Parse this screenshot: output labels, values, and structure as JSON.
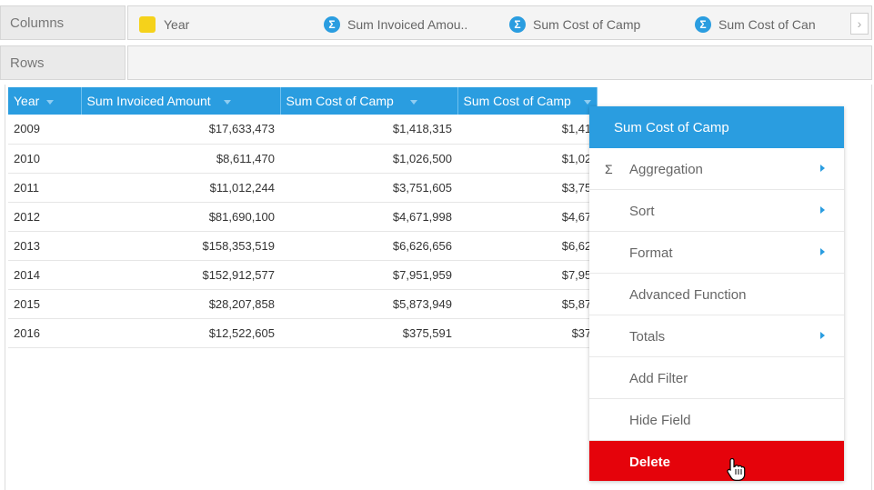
{
  "shelves": {
    "columns_label": "Columns",
    "rows_label": "Rows",
    "column_pills": [
      {
        "label": "Year",
        "kind": "dimension"
      },
      {
        "label": "Sum Invoiced Amou..",
        "kind": "measure"
      },
      {
        "label": "Sum Cost of Camp",
        "kind": "measure"
      },
      {
        "label": "Sum Cost of Can",
        "kind": "measure"
      }
    ],
    "scroll_right": "›"
  },
  "table": {
    "headers": [
      "Year",
      "Sum Invoiced Amount",
      "Sum Cost of Camp",
      "Sum Cost of Camp"
    ],
    "rows": [
      [
        "2009",
        "$17,633,473",
        "$1,418,315",
        "$1,41"
      ],
      [
        "2010",
        "$8,611,470",
        "$1,026,500",
        "$1,02"
      ],
      [
        "2011",
        "$11,012,244",
        "$3,751,605",
        "$3,75"
      ],
      [
        "2012",
        "$81,690,100",
        "$4,671,998",
        "$4,67"
      ],
      [
        "2013",
        "$158,353,519",
        "$6,626,656",
        "$6,62"
      ],
      [
        "2014",
        "$152,912,577",
        "$7,951,959",
        "$7,95"
      ],
      [
        "2015",
        "$28,207,858",
        "$5,873,949",
        "$5,87"
      ],
      [
        "2016",
        "$12,522,605",
        "$375,591",
        "$37"
      ]
    ]
  },
  "context_menu": {
    "title": "Sum Cost of Camp",
    "items": [
      {
        "label": "Aggregation",
        "icon": "sigma-icon",
        "submenu": true
      },
      {
        "label": "Sort",
        "submenu": true
      },
      {
        "label": "Format",
        "submenu": true
      },
      {
        "label": "Advanced Function",
        "submenu": false
      },
      {
        "label": "Totals",
        "submenu": true
      },
      {
        "label": "Add Filter",
        "submenu": false
      },
      {
        "label": "Hide Field",
        "submenu": false
      }
    ],
    "delete_label": "Delete"
  },
  "colors": {
    "accent": "#2a9de0",
    "dimension": "#f5d21b",
    "delete": "#e5030b"
  }
}
